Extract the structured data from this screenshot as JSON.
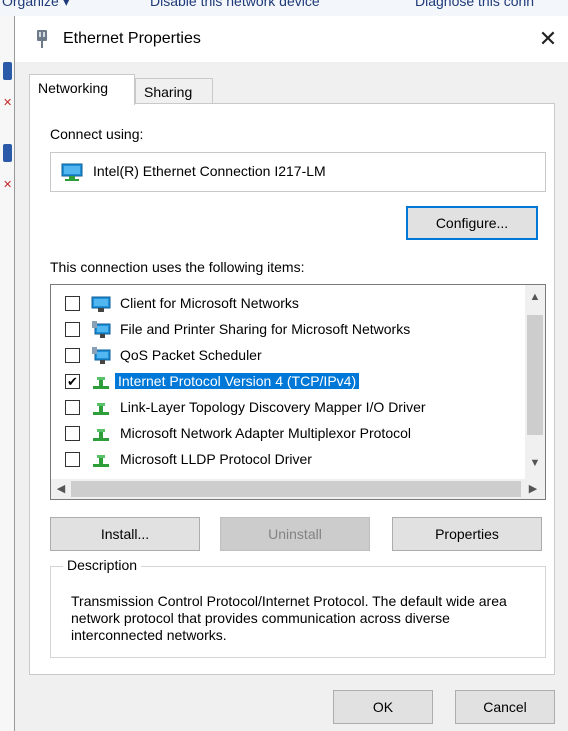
{
  "background_window": {
    "toolbar_items": [
      "Organize ▾",
      "Disable this network device",
      "Diagnose this conn"
    ]
  },
  "dialog": {
    "title": "Ethernet Properties",
    "close_symbol": "✕",
    "tabs": [
      {
        "label": "Networking",
        "active": true
      },
      {
        "label": "Sharing",
        "active": false
      }
    ],
    "connect_using_label": "Connect using:",
    "adapter_name": "Intel(R) Ethernet Connection I217-LM",
    "configure_label": "Configure...",
    "items_label": "This connection uses the following items:",
    "items": [
      {
        "label": "Client for Microsoft Networks",
        "checked": false,
        "icon": "network-client-icon",
        "selected": false
      },
      {
        "label": "File and Printer Sharing for Microsoft Networks",
        "checked": false,
        "icon": "network-service-icon",
        "selected": false
      },
      {
        "label": "QoS Packet Scheduler",
        "checked": false,
        "icon": "network-service-icon",
        "selected": false
      },
      {
        "label": "Internet Protocol Version 4 (TCP/IPv4)",
        "checked": true,
        "icon": "protocol-icon",
        "selected": true
      },
      {
        "label": "Link-Layer Topology Discovery Mapper I/O Driver",
        "checked": false,
        "icon": "protocol-icon",
        "selected": false
      },
      {
        "label": "Microsoft Network Adapter Multiplexor Protocol",
        "checked": false,
        "icon": "protocol-icon",
        "selected": false
      },
      {
        "label": "Microsoft LLDP Protocol Driver",
        "checked": false,
        "icon": "protocol-icon",
        "selected": false
      }
    ],
    "install_label": "Install...",
    "uninstall_label": "Uninstall",
    "properties_label": "Properties",
    "description_legend": "Description",
    "description_text": "Transmission Control Protocol/Internet Protocol. The default wide area network protocol that provides communication across diverse interconnected networks.",
    "ok_label": "OK",
    "cancel_label": "Cancel"
  },
  "colors": {
    "selection": "#0078d7",
    "dialog_bg": "#f0f0f0",
    "button_bg": "#e1e1e1"
  }
}
